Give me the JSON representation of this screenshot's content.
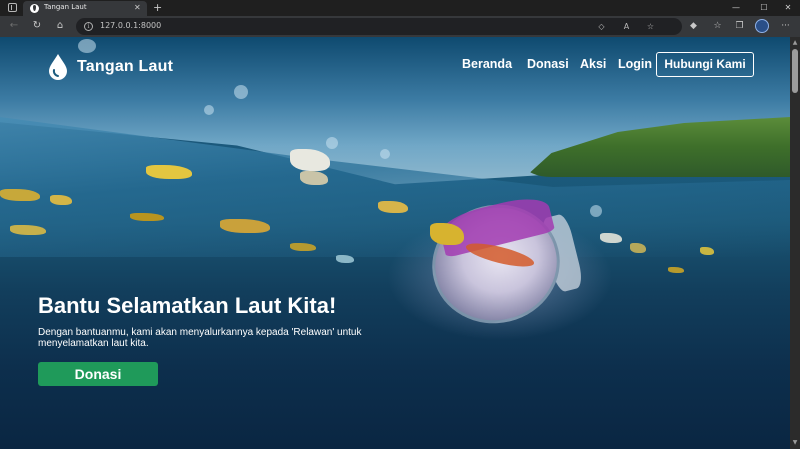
{
  "browser": {
    "tab_title": "Tangan Laut",
    "tab_close": "✕",
    "new_tab": "+",
    "url": "127.0.0.1:8000",
    "window_controls": {
      "minimize": "—",
      "maximize": "☐",
      "close": "✕"
    },
    "icons": [
      "window-menu-icon",
      "back-icon",
      "reload-icon",
      "home-icon",
      "site-info-icon",
      "extension-icon",
      "read-aloud-icon",
      "favorite-add-icon",
      "favorites-icon",
      "collections-icon",
      "copilot-icon",
      "profile-icon",
      "more-icon"
    ]
  },
  "site": {
    "brand": "Tangan Laut",
    "nav": [
      "Beranda",
      "Donasi",
      "Aksi",
      "Login"
    ],
    "contact_button": "Hubungi Kami",
    "hero": {
      "title": "Bantu Selamatkan Laut Kita!",
      "subtitle": "Dengan bantuanmu, kami akan menyalurkannya kepada 'Relawan' untuk menyelamatkan laut kita.",
      "cta": "Donasi"
    },
    "colors": {
      "cta": "#1f9a5a",
      "text": "#ffffff",
      "ocean": "#123e5c"
    }
  }
}
